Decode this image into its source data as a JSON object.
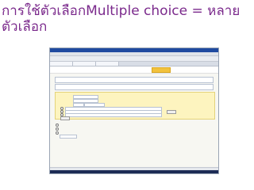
{
  "slide": {
    "title_line1": "การใช้ตัวเลือกMultiple choice  = หลาย",
    "title_line2": "ตัวเลือก"
  }
}
